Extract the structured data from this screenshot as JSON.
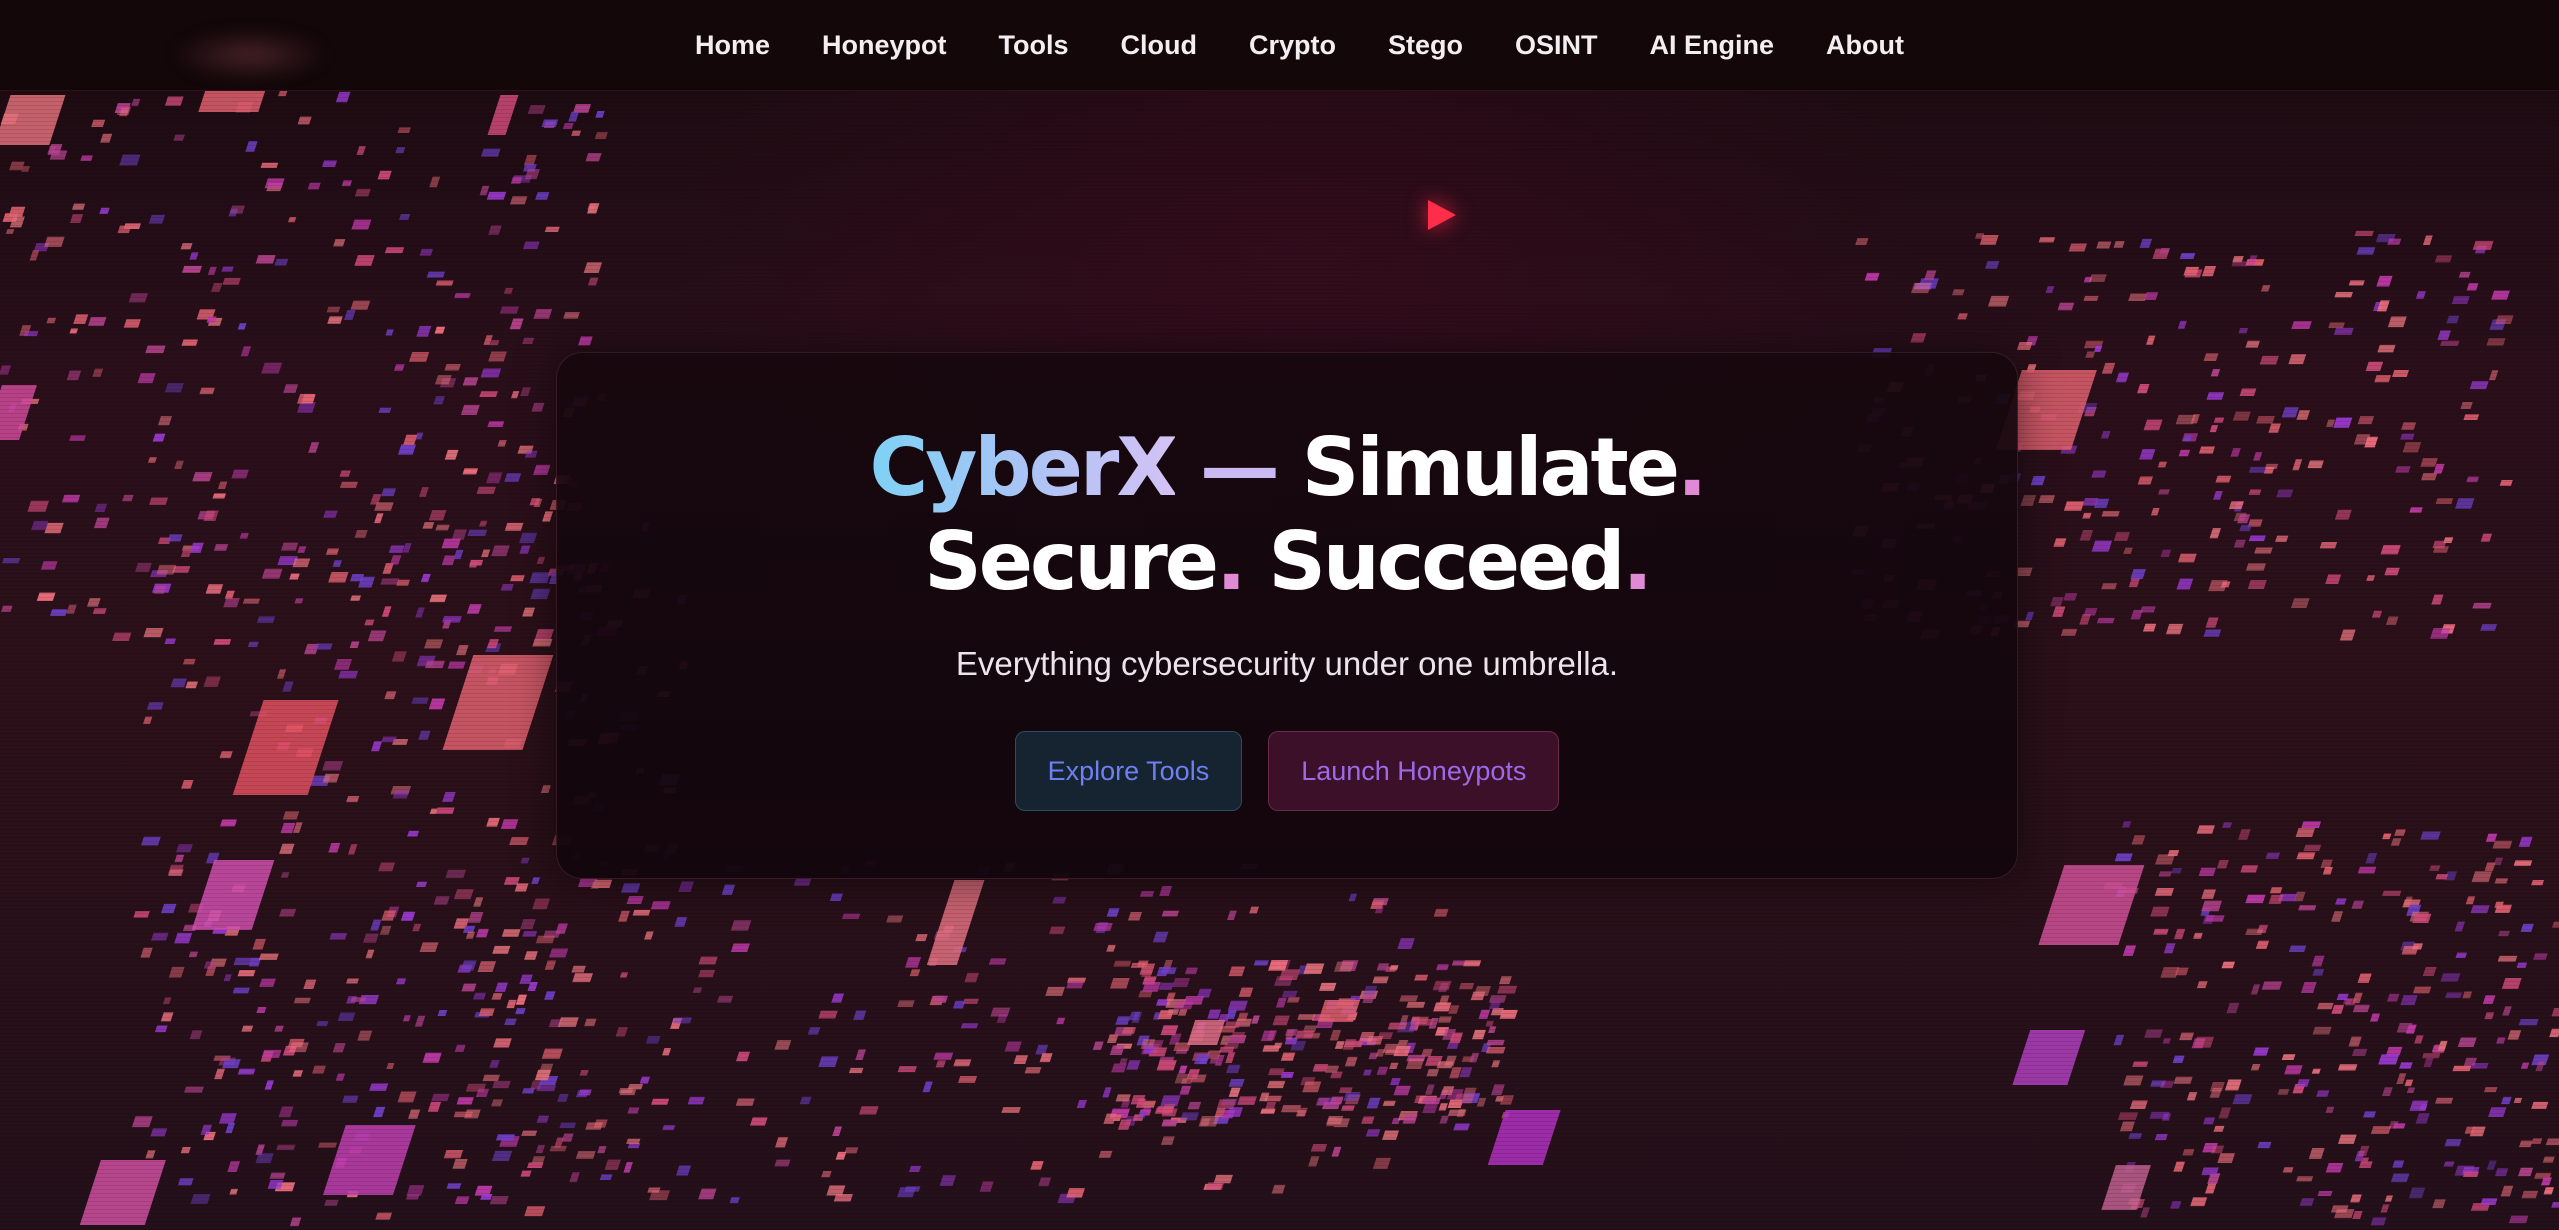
{
  "nav": {
    "items": [
      "Home",
      "Honeypot",
      "Tools",
      "Cloud",
      "Crypto",
      "Stego",
      "OSINT",
      "AI Engine",
      "About"
    ]
  },
  "hero": {
    "brand": "CyberX",
    "dash": "—",
    "word1": "Simulate",
    "word2": "Secure",
    "word3": "Succeed",
    "dot": ".",
    "subtitle": "Everything cybersecurity under one umbrella.",
    "primary_button": "Explore Tools",
    "secondary_button": "Launch Honeypots"
  },
  "icons": {
    "play": "play-icon"
  },
  "colors": {
    "background": "#1c0b12",
    "nav_background": "#130709",
    "play_accent": "#ff2d4a",
    "brand_gradient_start": "#7ed1f5",
    "brand_gradient_end": "#d4c2f5",
    "accent_dot": "#e08ad6",
    "button_primary_text": "#6e7ff0",
    "button_secondary_text": "#9b6ae8"
  }
}
